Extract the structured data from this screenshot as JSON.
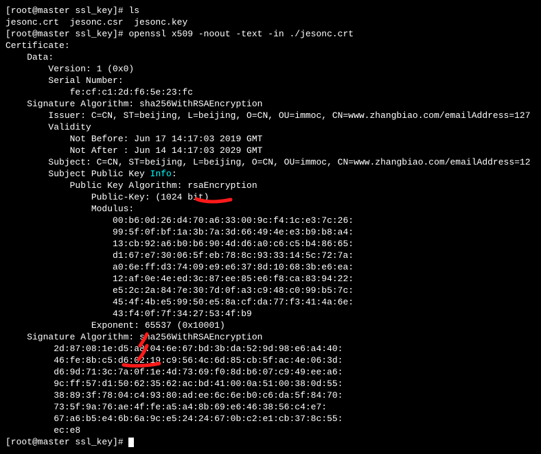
{
  "prompt": {
    "user": "root",
    "host": "master",
    "dir": "ssl_key",
    "open": "[root@master ssl_key]# "
  },
  "cmd1": "ls",
  "ls_output": "jesonc.crt  jesonc.csr  jesonc.key",
  "cmd2": "openssl x509 -noout -text -in ./jesonc.crt",
  "out": {
    "l01": "Certificate:",
    "l02": "    Data:",
    "l03": "        Version: 1 (0x0)",
    "l04": "        Serial Number:",
    "l05": "            fe:cf:c1:2d:f6:5e:23:fc",
    "l06": "    Signature Algorithm: sha256WithRSAEncryption",
    "l07": "        Issuer: C=CN, ST=beijing, L=beijing, O=CN, OU=immoc, CN=www.zhangbiao.com/emailAddress=127",
    "l08": "        Validity",
    "l09": "            Not Before: Jun 17 14:17:03 2019 GMT",
    "l10": "            Not After : Jun 14 14:17:03 2029 GMT",
    "l11": "        Subject: C=CN, ST=beijing, L=beijing, O=CN, OU=immoc, CN=www.zhangbiao.com/emailAddress=12",
    "l12a": "        Subject Public Key ",
    "l12b": "Info",
    "l12c": ":",
    "l13": "            Public Key Algorithm: rsaEncryption",
    "l14": "                Public-Key: (1024 bit)",
    "l15": "                Modulus:",
    "l16": "                    00:b6:0d:26:d4:70:a6:33:00:9c:f4:1c:e3:7c:26:",
    "l17": "                    99:5f:0f:bf:1a:3b:7a:3d:66:49:4e:e3:b9:b8:a4:",
    "l18": "                    13:cb:92:a6:b0:b6:90:4d:d6:a0:c6:c5:b4:86:65:",
    "l19": "                    d1:67:e7:30:06:5f:eb:78:8c:93:33:14:5c:72:7a:",
    "l20": "                    a0:6e:ff:d3:74:09:e9:e6:37:8d:10:68:3b:e6:ea:",
    "l21": "                    12:af:0e:4e:ed:3c:87:ee:85:e6:f8:ca:83:94:22:",
    "l22": "                    e5:2c:2a:84:7e:30:7d:0f:a3:c9:48:c0:99:b5:7c:",
    "l23": "                    45:4f:4b:e5:99:50:e5:8a:cf:da:77:f3:41:4a:6e:",
    "l24": "                    43:f4:0f:7f:34:27:53:4f:b9",
    "l25": "                Exponent: 65537 (0x10001)",
    "l26": "    Signature Algorithm: sha256WithRSAEncryption",
    "l27": "         2d:87:08:1e:d5:a8:04:6e:67:bd:3b:da:52:9d:98:e6:a4:40:",
    "l28": "         46:fe:8b:c5:d6:02:19:c9:56:4c:6d:85:cb:5f:ac:4e:06:3d:",
    "l29": "         d6:9d:71:3c:7a:0f:1e:4d:73:69:f0:8d:b6:07:c9:49:ee:a6:",
    "l30": "         9c:ff:57:d1:50:62:35:62:ac:bd:41:00:0a:51:00:38:0d:55:",
    "l31": "         38:89:3f:78:04:c4:93:80:ad:ee:6c:6e:b0:c6:da:5f:84:70:",
    "l32": "         73:5f:9a:76:ae:4f:fe:a5:a4:8b:69:e6:46:38:56:c4:e7:",
    "l33": "         67:a6:b5:e4:6b:6a:9c:e5:24:24:67:0b:c2:e1:cb:37:8c:55:",
    "l34": "         ec:e8"
  }
}
